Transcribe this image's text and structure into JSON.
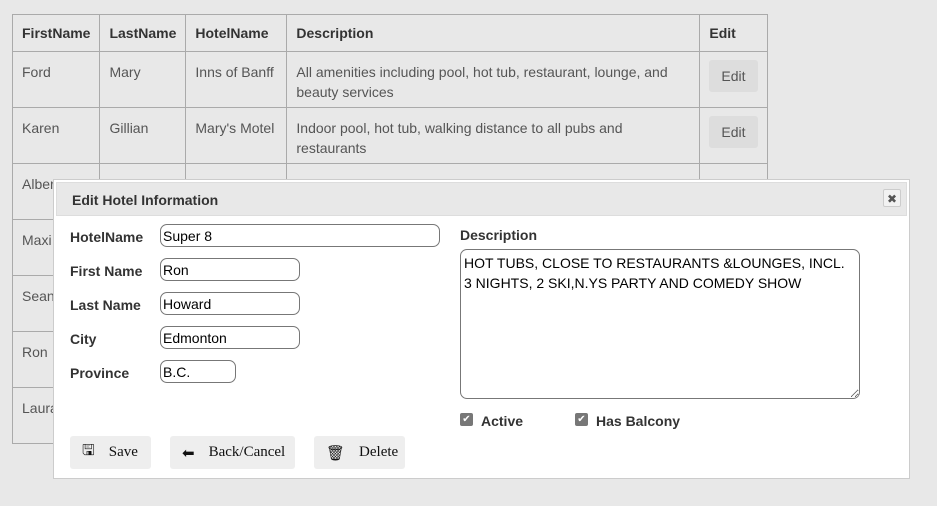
{
  "table": {
    "headers": [
      "FirstName",
      "LastName",
      "HotelName",
      "Description",
      "Edit"
    ],
    "rows": [
      {
        "first": "Ford",
        "last": "Mary",
        "hotel": "Inns of Banff",
        "desc": "All amenities including pool, hot tub, restaurant, lounge, and beauty services",
        "edit": "Edit"
      },
      {
        "first": "Karen",
        "last": "Gillian",
        "hotel": "Mary's Motel",
        "desc": "Indoor pool, hot tub, walking distance to all pubs and restaurants",
        "edit": "Edit"
      },
      {
        "first": "Alber",
        "last": "",
        "hotel": "",
        "desc": "",
        "edit": ""
      },
      {
        "first": "Maxi",
        "last": "",
        "hotel": "",
        "desc": "",
        "edit": ""
      },
      {
        "first": "Sean",
        "last": "",
        "hotel": "",
        "desc": "",
        "edit": ""
      },
      {
        "first": "Ron",
        "last": "",
        "hotel": "",
        "desc": "",
        "edit": ""
      },
      {
        "first": "Laura",
        "last": "",
        "hotel": "",
        "desc": "",
        "edit": ""
      }
    ]
  },
  "modal": {
    "title": "Edit Hotel Information",
    "close": "✖",
    "fields": {
      "hotel_label": "HotelName",
      "hotel": "Super 8",
      "first_label": "First Name",
      "first": "Ron",
      "last_label": "Last Name",
      "last": "Howard",
      "city_label": "City",
      "city": "Edmonton",
      "province_label": "Province",
      "province": "B.C."
    },
    "description_label": "Description",
    "description": "HOT TUBS, CLOSE TO RESTAURANTS &LOUNGES, INCL. 3 NIGHTS, 2 SKI,N.YS PARTY AND COMEDY SHOW",
    "active_label": "Active",
    "active": true,
    "balcony_label": "Has Balcony",
    "balcony": true,
    "buttons": {
      "save": "Save",
      "back": "Back/Cancel",
      "delete": "Delete"
    }
  }
}
